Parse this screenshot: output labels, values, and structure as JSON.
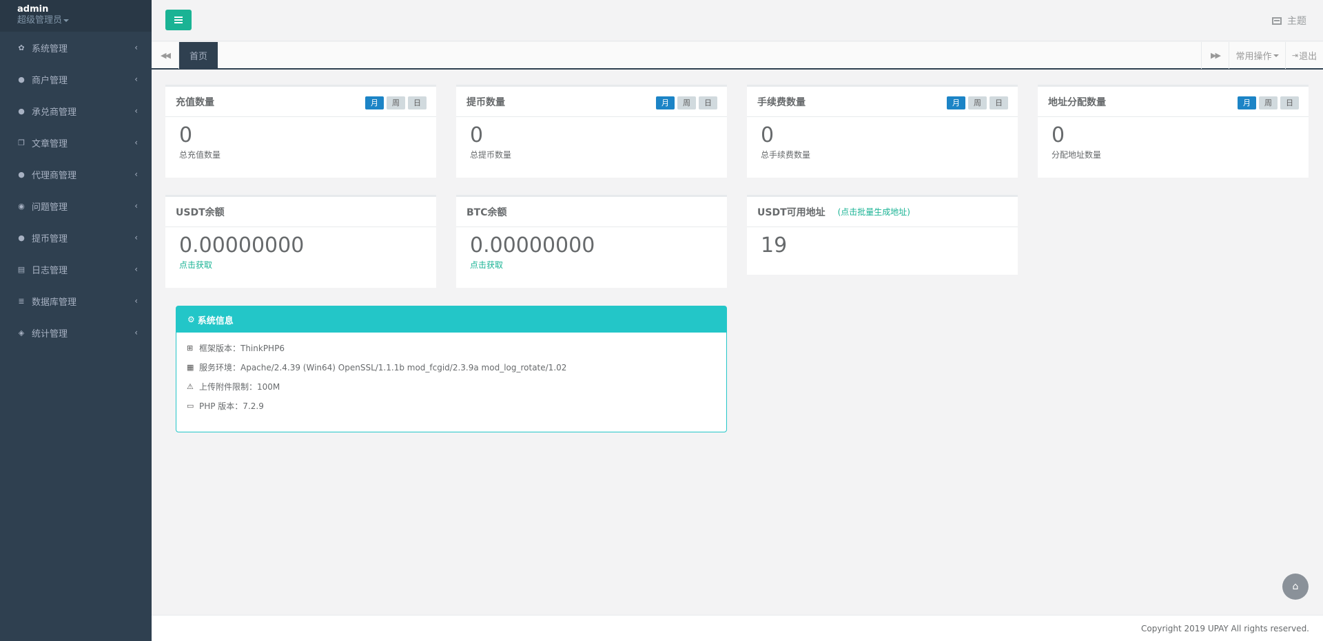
{
  "profile": {
    "name": "admin",
    "role": "超级管理员"
  },
  "sidebar": {
    "items": [
      {
        "label": "系统管理",
        "icon": "gear-icon"
      },
      {
        "label": "商户管理",
        "icon": "user-icon"
      },
      {
        "label": "承兑商管理",
        "icon": "user-icon"
      },
      {
        "label": "文章管理",
        "icon": "documents-icon"
      },
      {
        "label": "代理商管理",
        "icon": "user-icon"
      },
      {
        "label": "问题管理",
        "icon": "comment-icon"
      },
      {
        "label": "提币管理",
        "icon": "user-icon"
      },
      {
        "label": "日志管理",
        "icon": "card-icon"
      },
      {
        "label": "数据库管理",
        "icon": "database-icon"
      },
      {
        "label": "统计管理",
        "icon": "cube-icon"
      }
    ]
  },
  "header": {
    "theme_label": "主题"
  },
  "tabs": {
    "home": "首页",
    "ops_label": "常用操作",
    "logout_label": "退出"
  },
  "period_labels": [
    "月",
    "周",
    "日"
  ],
  "stats": [
    {
      "title": "充值数量",
      "value": "0",
      "caption": "总充值数量"
    },
    {
      "title": "提币数量",
      "value": "0",
      "caption": "总提币数量"
    },
    {
      "title": "手续费数量",
      "value": "0",
      "caption": "总手续费数量"
    },
    {
      "title": "地址分配数量",
      "value": "0",
      "caption": "分配地址数量"
    }
  ],
  "balances": [
    {
      "title": "USDT余额",
      "value": "0.00000000",
      "link": "点击获取"
    },
    {
      "title": "BTC余额",
      "value": "0.00000000",
      "link": "点击获取"
    }
  ],
  "address_card": {
    "title": "USDT可用地址",
    "link": "(点击批量生成地址)",
    "value": "19"
  },
  "sysinfo": {
    "title": "系统信息",
    "rows": [
      {
        "icon": "sitemap-icon",
        "text": "框架版本：ThinkPHP6"
      },
      {
        "icon": "windows-icon",
        "text": "服务环境：Apache/2.4.39 (Win64) OpenSSL/1.1.1b mod_fcgid/2.3.9a mod_log_rotate/1.02"
      },
      {
        "icon": "warning-icon",
        "text": "上传附件限制：100M"
      },
      {
        "icon": "credit-card-icon",
        "text": "PHP 版本：7.2.9"
      }
    ]
  },
  "footer": {
    "copyright": "Copyright 2019 UPAY All rights reserved."
  },
  "colors": {
    "sidebar": "#2f4050",
    "primary": "#1ab394",
    "info": "#23c6c8",
    "active_period": "#1c84c6"
  }
}
